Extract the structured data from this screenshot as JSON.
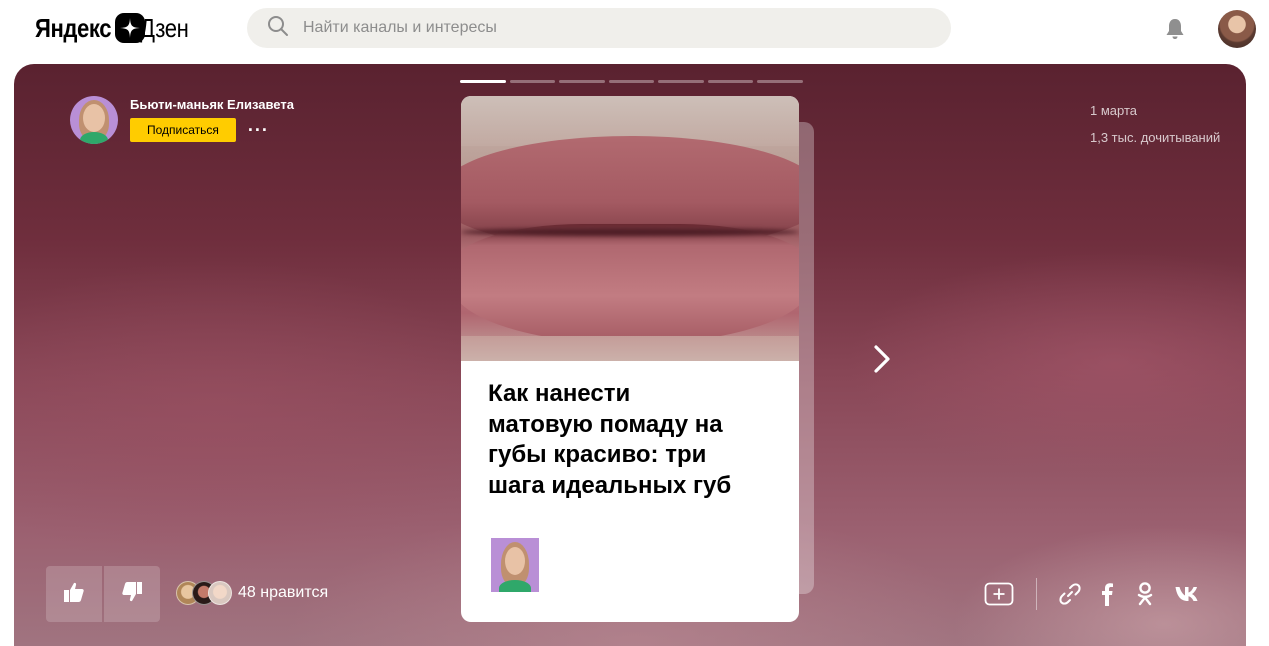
{
  "header": {
    "logo_left": "Яндекс",
    "logo_right": "Дзен",
    "search_placeholder": "Найти каналы и интересы"
  },
  "author": {
    "name": "Бьюти-маньяк Елизавета",
    "subscribe_label": "Подписаться",
    "more_label": "···"
  },
  "meta": {
    "date": "1 марта",
    "reads": "1,3 тыс. дочитываний"
  },
  "story": {
    "total_slides": 7,
    "active_slide": 1,
    "card_title": "Как нанести\nматовую помаду на\nгубы красиво: три\nшага идеальных  губ"
  },
  "reactions": {
    "likes_text": "48 нравится"
  },
  "colors": {
    "subscribe": "#ffcc00",
    "stage": "#7a3848"
  },
  "icons": [
    "search-icon",
    "bell-icon",
    "like-icon",
    "dislike-icon",
    "chevron-right-icon",
    "add-icon",
    "link-icon",
    "facebook-icon",
    "odnoklassniki-icon",
    "vk-icon"
  ]
}
